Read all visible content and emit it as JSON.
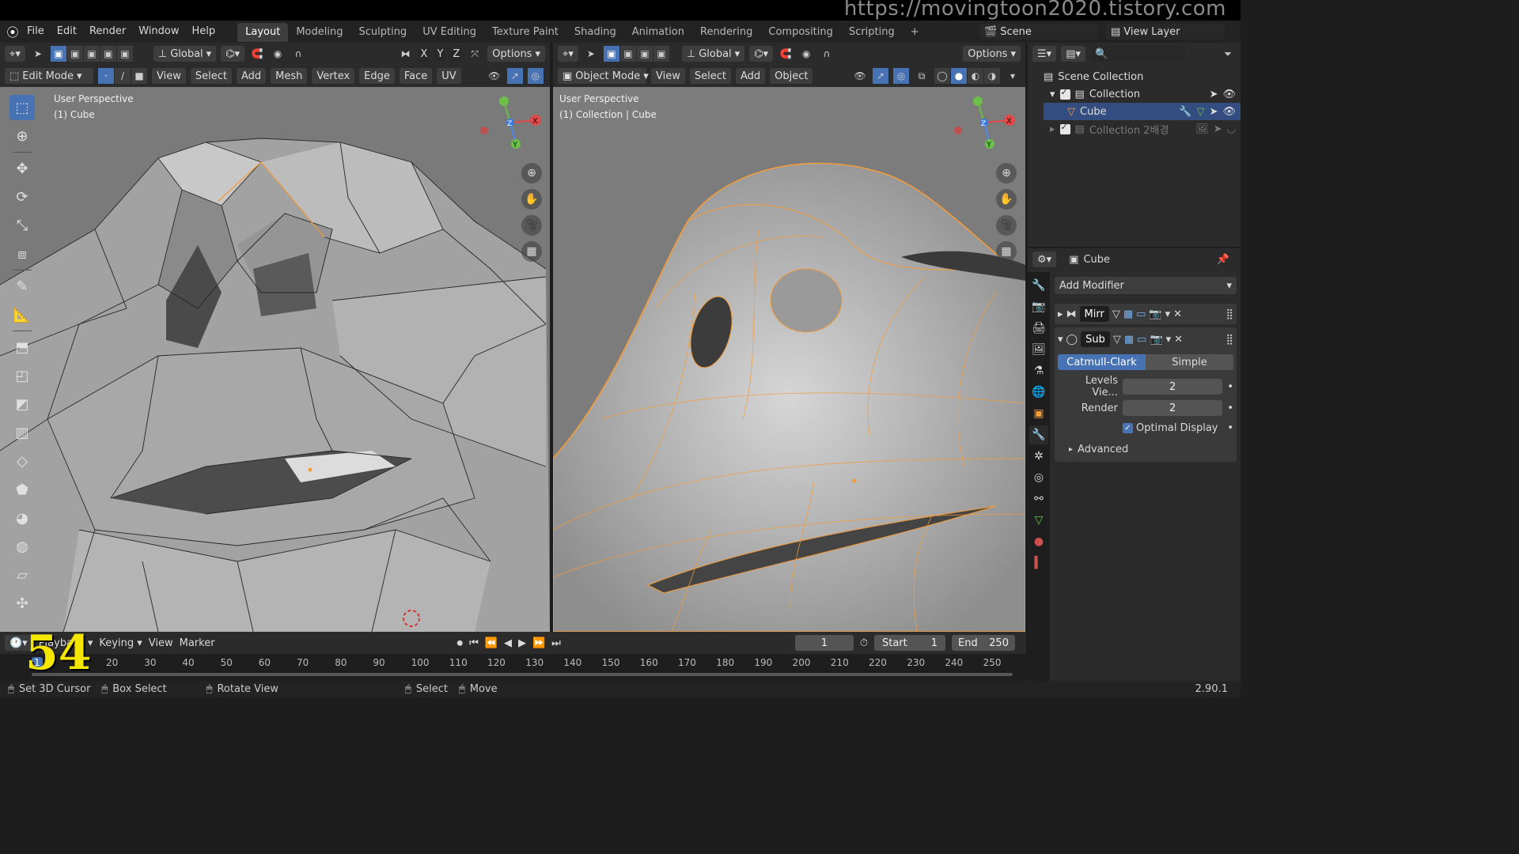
{
  "watermark": "https://movingtoon2020.tistory.com",
  "frame_overlay": "54",
  "menu": [
    "File",
    "Edit",
    "Render",
    "Window",
    "Help"
  ],
  "workspaces": [
    "Layout",
    "Modeling",
    "Sculpting",
    "UV Editing",
    "Texture Paint",
    "Shading",
    "Animation",
    "Rendering",
    "Compositing",
    "Scripting"
  ],
  "active_workspace": "Layout",
  "scene": {
    "scene_name": "Scene",
    "view_layer": "View Layer"
  },
  "left_viewport": {
    "header1": {
      "orientation": "Global",
      "axes": [
        "X",
        "Y",
        "Z"
      ],
      "options": "Options"
    },
    "header2": {
      "mode": "Edit Mode",
      "menus": [
        "View",
        "Select",
        "Add",
        "Mesh",
        "Vertex",
        "Edge",
        "Face",
        "UV"
      ]
    },
    "title": "User Perspective",
    "subtitle": "(1) Cube"
  },
  "right_viewport": {
    "header1": {
      "orientation": "Global",
      "options": "Options"
    },
    "header2": {
      "mode": "Object Mode",
      "menus": [
        "View",
        "Select",
        "Add",
        "Object"
      ]
    },
    "title": "User Perspective",
    "subtitle": "(1) Collection | Cube"
  },
  "gizmo_axes": {
    "x": "X",
    "y": "Y",
    "z": "Z"
  },
  "outliner": {
    "root": "Scene Collection",
    "items": [
      {
        "label": "Collection"
      },
      {
        "label": "Cube"
      },
      {
        "label": "Collection 2배경"
      }
    ]
  },
  "properties": {
    "object_name": "Cube",
    "add_modifier": "Add Modifier",
    "modifiers": [
      {
        "name": "Mirr"
      },
      {
        "name": "Sub"
      }
    ],
    "subdiv_types": [
      "Catmull-Clark",
      "Simple"
    ],
    "active_type": "Catmull-Clark",
    "levels_viewport_label": "Levels Vie...",
    "levels_viewport": "2",
    "render_label": "Render",
    "render_value": "2",
    "optimal_display": "Optimal Display",
    "advanced": "Advanced"
  },
  "timeline": {
    "menus": [
      "Playback",
      "Keying",
      "View",
      "Marker"
    ],
    "current_frame": "1",
    "start_label": "Start",
    "start": "1",
    "end_label": "End",
    "end": "250",
    "ruler": [
      "1",
      "20",
      "30",
      "40",
      "50",
      "60",
      "70",
      "80",
      "90",
      "100",
      "110",
      "120",
      "130",
      "140",
      "150",
      "160",
      "170",
      "180",
      "190",
      "200",
      "210",
      "220",
      "230",
      "240",
      "250"
    ]
  },
  "statusbar": {
    "items": [
      "Set 3D Cursor",
      "Box Select",
      "Rotate View",
      "Select",
      "Move"
    ],
    "version": "2.90.1"
  },
  "colors": {
    "accent": "#4772b3",
    "selection_orange": "#f39c3a",
    "viewport_bg": "#7c7c7c"
  }
}
